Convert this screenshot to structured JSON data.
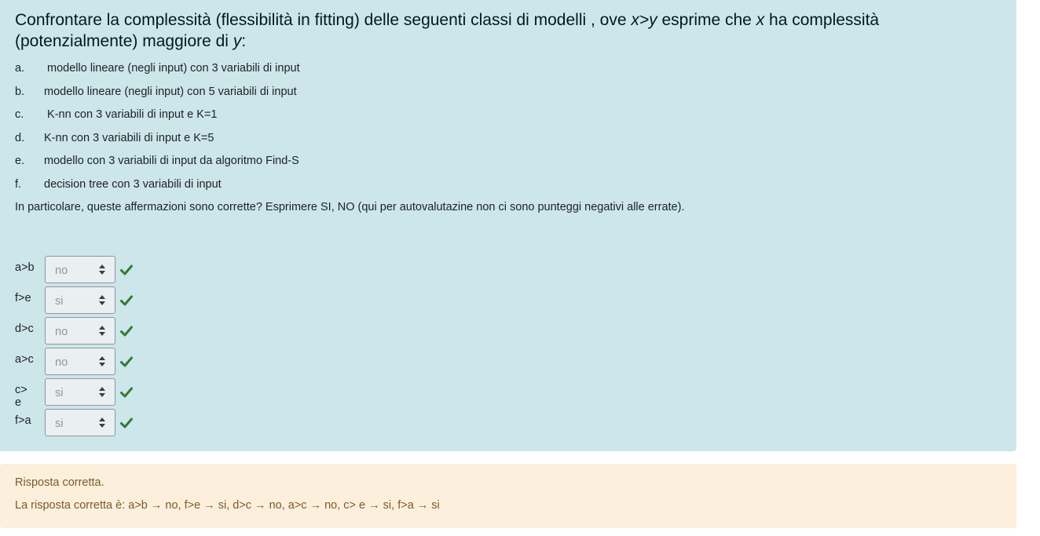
{
  "question": {
    "title_part1": "Confrontare la complessità (flessibilità in fitting) delle seguenti  classi di  modelli , ove ",
    "title_var_xy": "x>y",
    "title_part2": " esprime che ",
    "title_var_x": "x",
    "title_part3": " ha complessità (potenzialmente) maggiore di ",
    "title_var_y": "y",
    "title_part4": ":",
    "options": [
      {
        "letter": "a.",
        "text": " modello lineare (negli input) con 3 variabili di input"
      },
      {
        "letter": "b.",
        "text": "modello lineare (negli input)  con 5  variabili di input"
      },
      {
        "letter": "c.",
        "text": " K-nn con 3 variabili di input e  K=1"
      },
      {
        "letter": "d.",
        "text": "K-nn con 3 variabili di input e  K=5"
      },
      {
        "letter": "e.",
        "text": "modello con  3 variabili di input da algoritmo Find-S"
      },
      {
        "letter": "f.",
        "text": "decision tree con  3 variabili di input"
      }
    ],
    "prompt": "In particolare,  queste affermazioni sono  corrette? Esprimere SI, NO (qui per autovalutazine non ci sono punteggi negativi alle errate)."
  },
  "answers": [
    {
      "label": "a>b",
      "value": "no",
      "status": "correct"
    },
    {
      "label": "f>e",
      "value": "si",
      "status": "correct"
    },
    {
      "label": "d>c",
      "value": "no",
      "status": "correct"
    },
    {
      "label": "a>c",
      "value": "no",
      "status": "correct"
    },
    {
      "label": "c> e",
      "value": "si",
      "status": "correct"
    },
    {
      "label": "f>a",
      "value": "si",
      "status": "correct"
    }
  ],
  "feedback": {
    "status": "Risposta corretta.",
    "right_answer": "La risposta corretta è: a>b  → no, f>e → si, d>c → no, a>c → no, c> e → si, f>a → si"
  },
  "colors": {
    "question_bg": "#cce6ea",
    "feedback_bg": "#fcefdc",
    "check_green": "#357a32"
  }
}
